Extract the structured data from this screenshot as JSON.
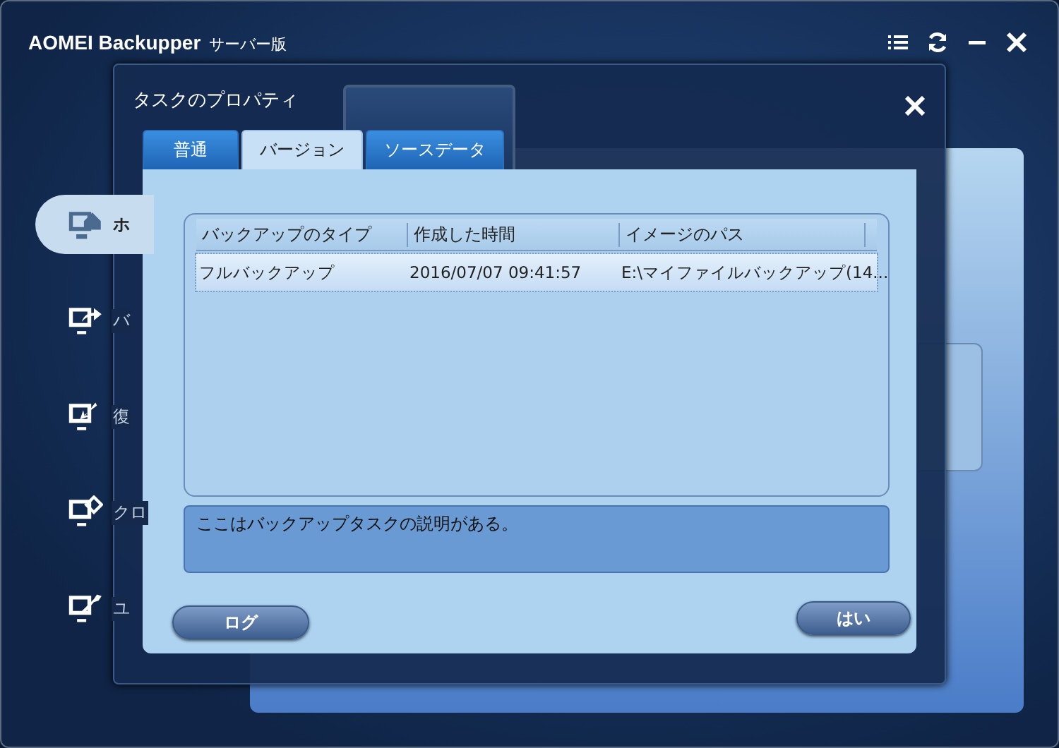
{
  "window": {
    "title": "AOMEI Backupper",
    "edition": "サーバー版"
  },
  "sidebar": {
    "items": [
      {
        "label": "ホ",
        "selected": true
      },
      {
        "label": "バ",
        "selected": false
      },
      {
        "label": "復",
        "selected": false
      },
      {
        "label": "クロ",
        "selected": false
      },
      {
        "label": "ユ",
        "selected": false
      }
    ]
  },
  "dialog": {
    "title": "タスクのプロパティ",
    "tabs": [
      {
        "label": "普通",
        "selected": false
      },
      {
        "label": "バージョン",
        "selected": true
      },
      {
        "label": "ソースデータ",
        "selected": false
      }
    ],
    "table": {
      "columns": [
        "バックアップのタイプ",
        "作成した時間",
        "イメージのパス"
      ],
      "rows": [
        {
          "cells": [
            "フルバックアップ",
            "2016/07/07 09:41:57",
            "E:\\マイファイルバックアップ(14..."
          ],
          "selected": true
        }
      ]
    },
    "description": "ここはバックアップタスクの説明がある。",
    "buttons": [
      {
        "label": "ログ",
        "kind": "left"
      },
      {
        "label": "はい",
        "kind": "right"
      }
    ]
  }
}
